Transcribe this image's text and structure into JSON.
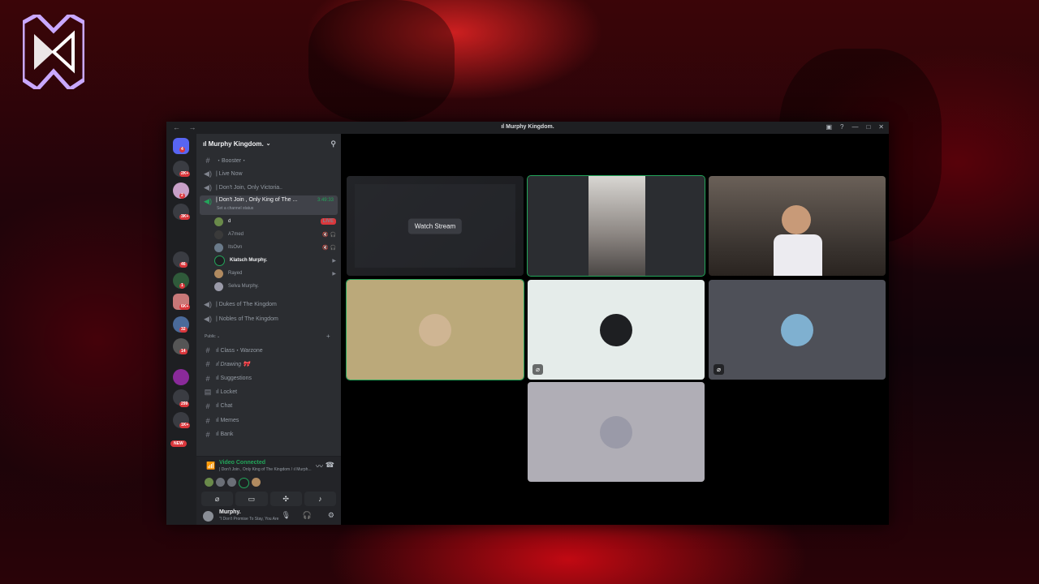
{
  "window": {
    "title": "ıl Murphy Kingdom."
  },
  "server": {
    "name": "ıl Murphy Kingdom."
  },
  "rail_badges": [
    "4",
    "2K+",
    "2",
    "3K+",
    "46",
    "1",
    "6K+",
    "32",
    "14",
    "299",
    "1K+"
  ],
  "rail_new": "NEW",
  "channels": {
    "booster": "・Booster・",
    "live_now": "| Live Now",
    "dont_join_victoria": "| Don't Join, Only Victoria..",
    "active": {
      "name": "| Don't Join , Only King of The ...",
      "timer": "3:49:33",
      "status": "Set a channel status"
    },
    "dukes": "| Dukes of The Kingdom",
    "nobles": "| Nobles of The Kingdom"
  },
  "voice_users": [
    {
      "name": "d",
      "right": "LIVE"
    },
    {
      "name": "A7med",
      "right": "🔇 🎧"
    },
    {
      "name": "ItsOvn",
      "right": "🔇 🎧"
    },
    {
      "name": "Klatsch Murphy.",
      "right": "▶"
    },
    {
      "name": "Rayed",
      "right": "▶"
    },
    {
      "name": "Selva Murphy.",
      "right": ""
    }
  ],
  "category": {
    "label": "Public",
    "plus": "+"
  },
  "public_channels": [
    "ıl Class・Warzone",
    "ıl Drawing 🎀",
    "ıl Suggestions",
    "ıl Locket",
    "ıl Chat",
    "ıl Memes",
    "ıl Bank"
  ],
  "voice_panel": {
    "connected": "Video Connected",
    "location": "| Don't Join , Only King of The Kingdom / ıl Murph..."
  },
  "user_panel": {
    "name": "Murphy.",
    "status": "\"I Don't Promise To Stay, You Are"
  },
  "stage": {
    "watch_stream": "Watch Stream"
  },
  "colors": {
    "discord_green": "#23a55a",
    "live_red": "#da373c",
    "sidebar_bg": "#2b2d31",
    "rail_bg": "#1e1f22"
  }
}
